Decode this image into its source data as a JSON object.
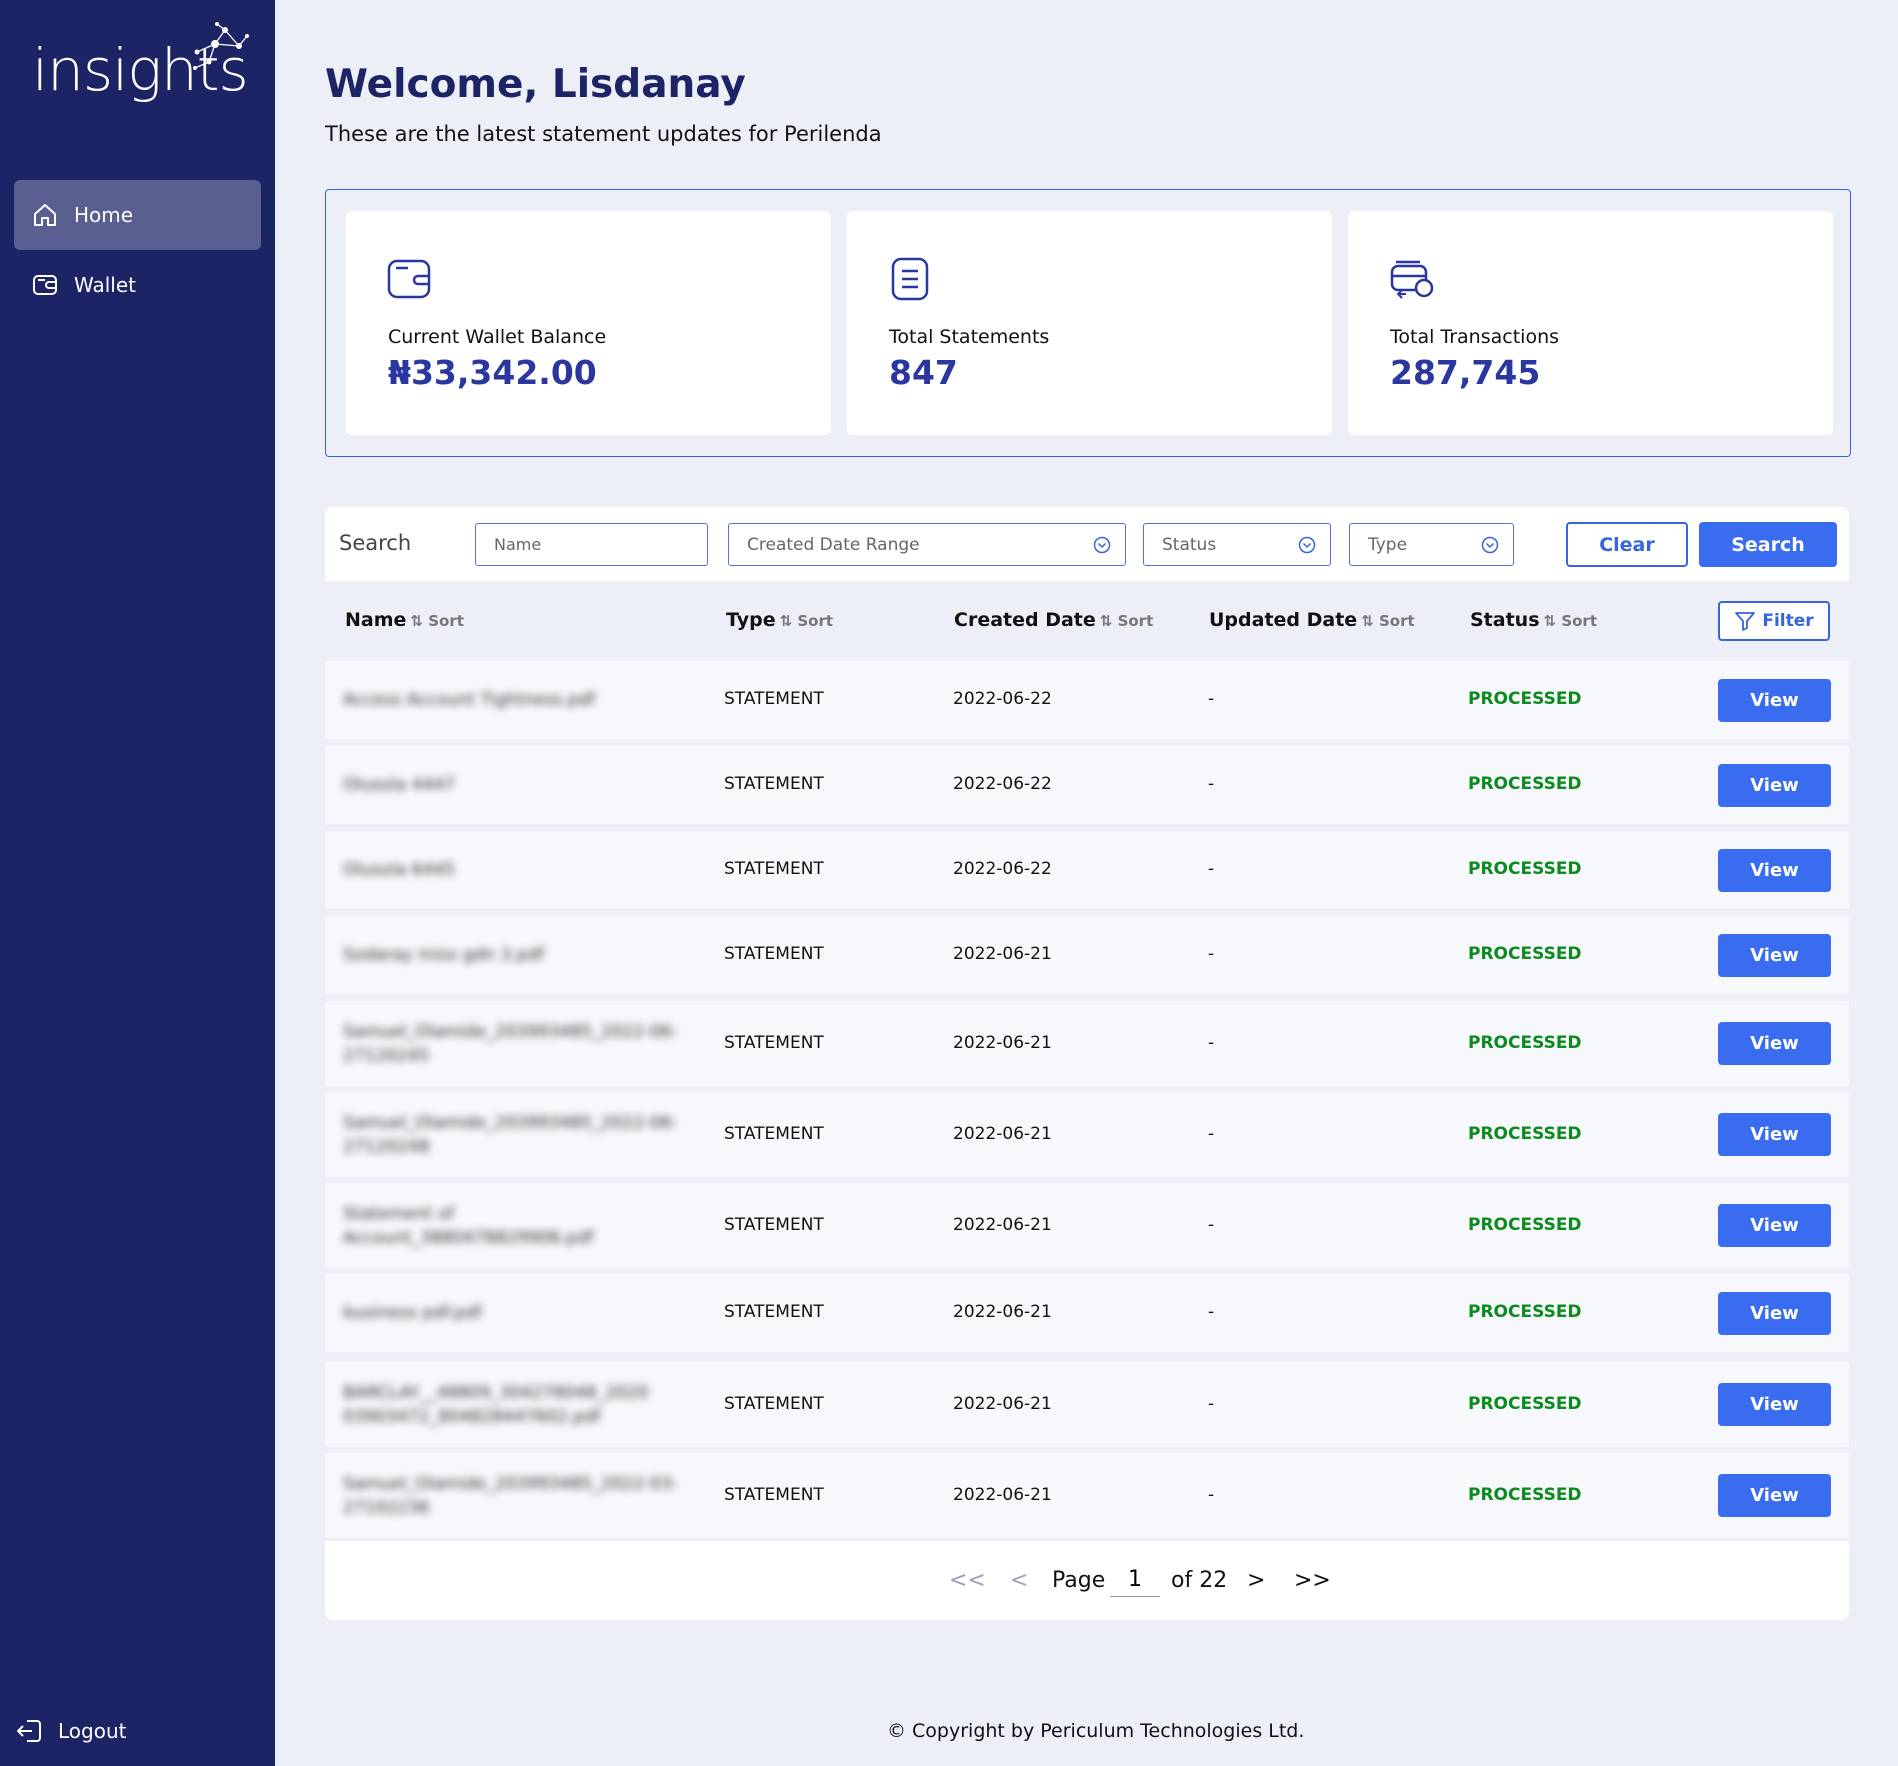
{
  "brand": {
    "logo_text": "insights"
  },
  "sidebar": {
    "items": [
      {
        "label": "Home",
        "icon": "home-icon",
        "active": true
      },
      {
        "label": "Wallet",
        "icon": "wallet-icon",
        "active": false
      }
    ],
    "logout_label": "Logout"
  },
  "header": {
    "title": "Welcome, Lisdanay",
    "subtitle": "These are the latest statement updates for Perilenda"
  },
  "stats": [
    {
      "label": "Current Wallet Balance",
      "value": "₦33,342.00",
      "icon": "wallet-icon"
    },
    {
      "label": "Total Statements",
      "value": "847",
      "icon": "document-icon"
    },
    {
      "label": "Total Transactions",
      "value": "287,745",
      "icon": "cards-exchange-icon"
    }
  ],
  "search": {
    "label": "Search",
    "name_placeholder": "Name",
    "date_range_placeholder": "Created Date Range",
    "status_placeholder": "Status",
    "type_placeholder": "Type",
    "clear_label": "Clear",
    "search_label": "Search"
  },
  "table": {
    "columns": [
      {
        "label": "Name",
        "sort": "Sort"
      },
      {
        "label": "Type",
        "sort": "Sort"
      },
      {
        "label": "Created Date",
        "sort": "Sort"
      },
      {
        "label": "Updated Date",
        "sort": "Sort"
      },
      {
        "label": "Status",
        "sort": "Sort"
      }
    ],
    "filter_label": "Filter",
    "view_label": "View",
    "rows": [
      {
        "name": "Access Account Tightness.pdf",
        "type": "STATEMENT",
        "created": "2022-06-22",
        "updated": "-",
        "status": "PROCESSED"
      },
      {
        "name": "Olusola 4447",
        "type": "STATEMENT",
        "created": "2022-06-22",
        "updated": "-",
        "status": "PROCESSED"
      },
      {
        "name": "Olusola 6445",
        "type": "STATEMENT",
        "created": "2022-06-22",
        "updated": "-",
        "status": "PROCESSED"
      },
      {
        "name": "Sodaray miss gdn 3.pdf",
        "type": "STATEMENT",
        "created": "2022-06-21",
        "updated": "-",
        "status": "PROCESSED"
      },
      {
        "name": "Samuel_Olamide_203993485_2022-06-27120245",
        "type": "STATEMENT",
        "created": "2022-06-21",
        "updated": "-",
        "status": "PROCESSED"
      },
      {
        "name": "Samuel_Olamide_203993485_2022-06-27120248",
        "type": "STATEMENT",
        "created": "2022-06-21",
        "updated": "-",
        "status": "PROCESSED"
      },
      {
        "name": "Statement of Account_3880478829906.pdf",
        "type": "STATEMENT",
        "created": "2022-06-21",
        "updated": "-",
        "status": "PROCESSED"
      },
      {
        "name": "business pdf.pdf",
        "type": "STATEMENT",
        "created": "2022-06-21",
        "updated": "-",
        "status": "PROCESSED"
      },
      {
        "name": "BARCLAY__48809_304278048_2020 03903472_804828447602.pdf",
        "type": "STATEMENT",
        "created": "2022-06-21",
        "updated": "-",
        "status": "PROCESSED"
      },
      {
        "name": "Samuel_Olamide_203993485_2022-03-27102236",
        "type": "STATEMENT",
        "created": "2022-06-21",
        "updated": "-",
        "status": "PROCESSED"
      }
    ]
  },
  "pagination": {
    "first": "<<",
    "prev": "<",
    "page_label": "Page",
    "current_page": "1",
    "of_label": "of 22",
    "next": ">",
    "last": ">>"
  },
  "footer": {
    "copyright": "© Copyright by Periculum Technologies Ltd."
  },
  "colors": {
    "sidebar_bg": "#1d2466",
    "accent": "#3a6cf0",
    "stat_value": "#2b37a0",
    "status_processed": "#0b8a1e"
  }
}
